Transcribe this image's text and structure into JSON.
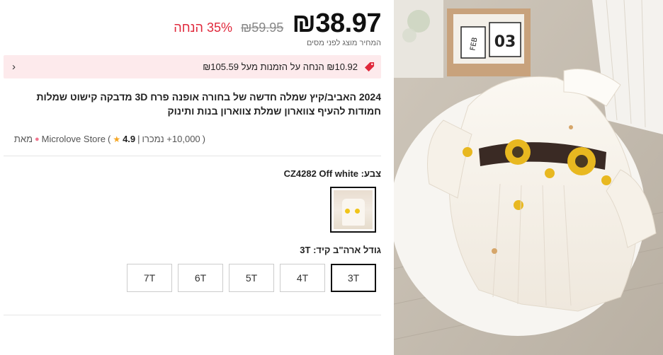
{
  "product": {
    "price": "₪38.97",
    "old_price": "₪59.95",
    "discount": "35% הנחה",
    "tax_note": "המחיר מוצג לפני מסים",
    "title": "2024 האביב/קיץ שמלה חדשה של בחורה אופנה פרח 3D מדבקה קישוט שמלות חמודות להעיף צווארון שמלת צווארון בנות ותינוק"
  },
  "promo": {
    "text": "₪10.92 הנחה על הזמנות מעל ₪105.59",
    "icon": "price-tag-icon",
    "chevron": "‹"
  },
  "store": {
    "open_paren": "(",
    "sold": "10,000+ נמכרו",
    "separator": "|",
    "rating": "4.9",
    "close_paren": ")",
    "name": "Microlove Store",
    "suffix": "מאת"
  },
  "color": {
    "label": "צבע: CZ4282 Off white"
  },
  "size": {
    "label": "גודל ארה\"ב קיד: 3T",
    "options": [
      "3T",
      "4T",
      "5T",
      "6T",
      "7T"
    ],
    "selected": "3T"
  },
  "colors": {
    "discount": "#e0283b",
    "promo_bg": "#fdeaec",
    "star": "#f5a623"
  }
}
